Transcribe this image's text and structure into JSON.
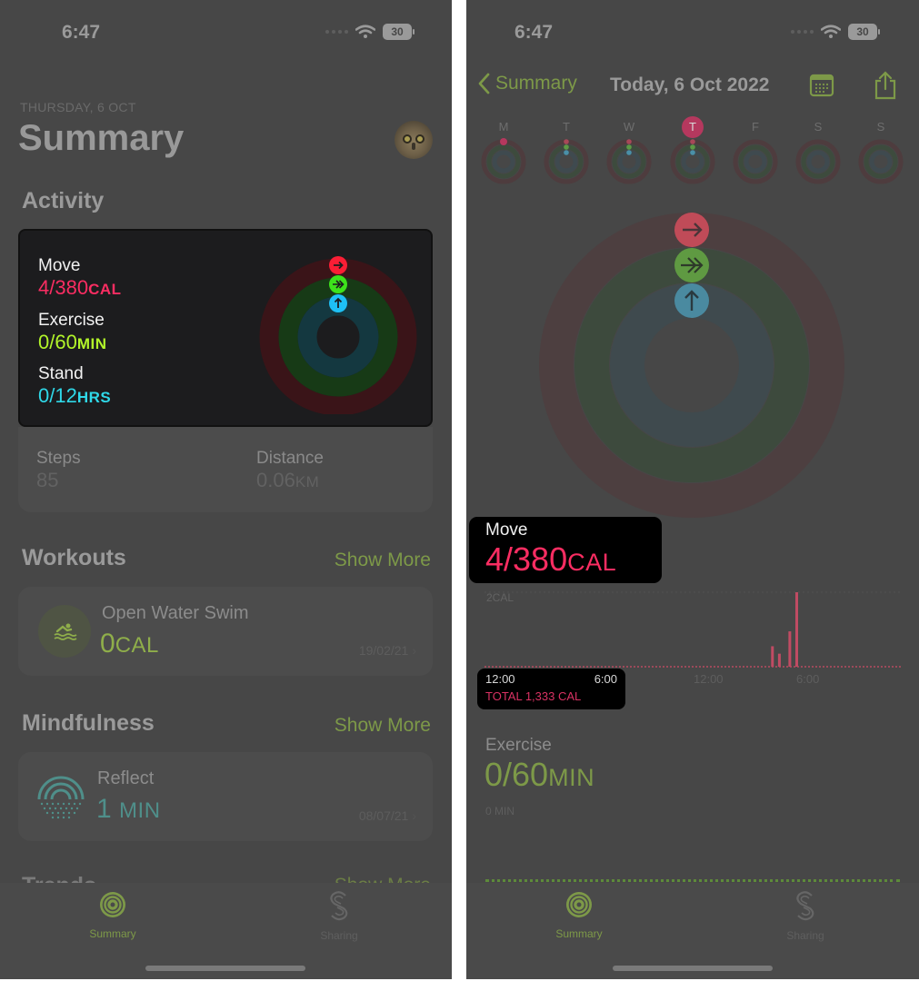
{
  "left_screen": {
    "status_bar": {
      "time": "6:47",
      "battery": "30",
      "wifi_icon": "wifi-icon"
    },
    "header": {
      "date": "THURSDAY, 6 OCT",
      "title": "Summary",
      "avatar_icon": "owl-avatar"
    },
    "activity": {
      "section_title": "Activity",
      "move": {
        "label": "Move",
        "value": "4/380",
        "unit": "CAL",
        "progress": 0.0105
      },
      "exercise": {
        "label": "Exercise",
        "value": "0/60",
        "unit": "MIN",
        "progress": 0
      },
      "stand": {
        "label": "Stand",
        "value": "0/12",
        "unit": "HRS",
        "progress": 0
      },
      "steps": {
        "label": "Steps",
        "value": "85"
      },
      "distance": {
        "label": "Distance",
        "value": "0.06",
        "unit": "KM"
      }
    },
    "workouts": {
      "section_title": "Workouts",
      "show_more": "Show More",
      "items": [
        {
          "title": "Open Water Swim",
          "value": "0",
          "unit": "CAL",
          "date": "19/02/21",
          "icon": "swim-icon"
        }
      ]
    },
    "mindfulness": {
      "section_title": "Mindfulness",
      "show_more": "Show More",
      "items": [
        {
          "title": "Reflect",
          "value": "1",
          "unit": "MIN",
          "date": "08/07/21",
          "icon": "reflect-icon"
        }
      ]
    },
    "trends_peek": {
      "title": "Trends",
      "show_more": "Show More"
    },
    "tab_bar": {
      "tabs": [
        {
          "label": "Summary",
          "active": true,
          "icon": "activity-rings-icon"
        },
        {
          "label": "Sharing",
          "active": false,
          "icon": "sharing-icon"
        }
      ]
    }
  },
  "right_screen": {
    "status_bar": {
      "time": "6:47",
      "battery": "30"
    },
    "nav": {
      "back_label": "Summary",
      "title": "Today, 6 Oct 2022",
      "calendar_icon": "calendar-icon",
      "share_icon": "share-icon"
    },
    "week": {
      "days": [
        {
          "letter": "M",
          "today": false
        },
        {
          "letter": "T",
          "today": false
        },
        {
          "letter": "W",
          "today": false
        },
        {
          "letter": "T",
          "today": true
        },
        {
          "letter": "F",
          "today": false
        },
        {
          "letter": "S",
          "today": false
        },
        {
          "letter": "S",
          "today": false
        }
      ]
    },
    "move": {
      "label": "Move",
      "value": "4/380",
      "unit": "CAL"
    },
    "move_chart_total": {
      "start": "12:00",
      "mid": "6:00",
      "total": "TOTAL 1,333 CAL"
    },
    "exercise": {
      "label": "Exercise",
      "value": "0/60",
      "unit": "MIN",
      "ylabel": "0 MIN"
    },
    "tab_bar": {
      "tabs": [
        {
          "label": "Summary",
          "active": true
        },
        {
          "label": "Sharing",
          "active": false
        }
      ]
    }
  },
  "colors": {
    "move": "#fa2d62",
    "exercise": "#b2f52a",
    "stand": "#2fd8e8",
    "accent": "#7d9948"
  },
  "chart_data": {
    "type": "bar",
    "title": "Move",
    "ylabel": "2CAL",
    "x_ticks": [
      "12:00",
      "6:00",
      "12:00",
      "6:00"
    ],
    "ylim": [
      0,
      2
    ],
    "bars": [
      {
        "x_hour": 4.6,
        "value": 0.55
      },
      {
        "x_hour": 5.0,
        "value": 0.35
      },
      {
        "x_hour": 5.6,
        "value": 0.95
      },
      {
        "x_hour": 6.0,
        "value": 2.0
      }
    ],
    "x_range_hours": [
      -12,
      12
    ]
  }
}
